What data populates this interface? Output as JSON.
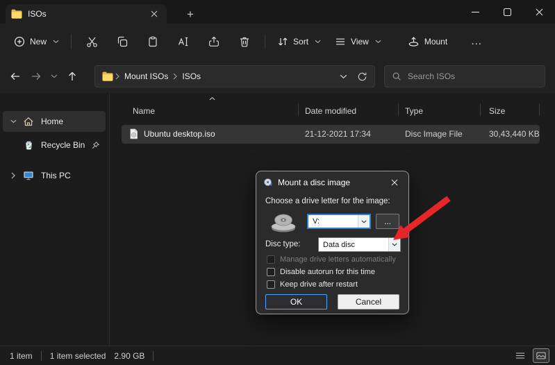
{
  "window": {
    "tab_title": "ISOs"
  },
  "toolbar": {
    "new_label": "New",
    "sort_label": "Sort",
    "view_label": "View",
    "mount_label": "Mount",
    "more_label": "…"
  },
  "address": {
    "crumb1": "Mount ISOs",
    "crumb2": "ISOs",
    "search_placeholder": "Search ISOs"
  },
  "sidebar": {
    "home": "Home",
    "recycle_bin": "Recycle Bin",
    "this_pc": "This PC"
  },
  "file_list": {
    "columns": [
      "Name",
      "Date modified",
      "Type",
      "Size"
    ],
    "rows": [
      {
        "name": "Ubuntu desktop.iso",
        "date_modified": "21-12-2021 17:34",
        "type": "Disc Image File",
        "size": "30,43,440 KB",
        "selected": true
      }
    ]
  },
  "dialog": {
    "title": "Mount a disc image",
    "drive_letter_label": "Choose a drive letter for the image:",
    "drive_letter_value": "V:",
    "browse_label": "...",
    "disc_type_label": "Disc type:",
    "disc_type_value": "Data disc",
    "checkboxes": [
      {
        "label": "Manage drive letters automatically",
        "checked": false,
        "enabled": false
      },
      {
        "label": "Disable autorun for this time",
        "checked": false,
        "enabled": true
      },
      {
        "label": "Keep drive after restart",
        "checked": false,
        "enabled": true
      }
    ],
    "ok_label": "OK",
    "cancel_label": "Cancel"
  },
  "status_bar": {
    "item_count_text": "1 item",
    "selection_text": "1 item selected",
    "selection_size": "2.90 GB"
  },
  "colors": {
    "accent_blue": "#2f7fd6",
    "selection_focus": "#4da3ff",
    "annotation_arrow_red": "#e8262a",
    "folder_yellow": "#f6c94f"
  },
  "icons": {
    "tab": "folder-icon",
    "new": "plus-circle-icon",
    "cut": "scissors-icon",
    "copy": "copy-icon",
    "paste": "clipboard-icon",
    "rename": "rename-icon",
    "share": "share-icon",
    "delete": "trash-icon",
    "sort": "sort-arrows-icon",
    "view": "list-lines-icon",
    "mount": "mount-drive-icon",
    "back": "arrow-left-icon",
    "forward": "arrow-right-icon",
    "recent": "chevron-down-icon",
    "up": "arrow-up-icon",
    "refresh": "refresh-icon",
    "search": "magnifier-icon",
    "home": "house-icon",
    "recycle": "recycle-bin-icon",
    "this_pc": "monitor-icon",
    "pinned": "pin-icon",
    "file": "disc-image-file-icon",
    "dialog_title": "disc-mount-icon",
    "drive": "disc-drive-icon",
    "minimize": "minimize-icon",
    "maximize": "maximize-icon",
    "close": "close-icon"
  }
}
